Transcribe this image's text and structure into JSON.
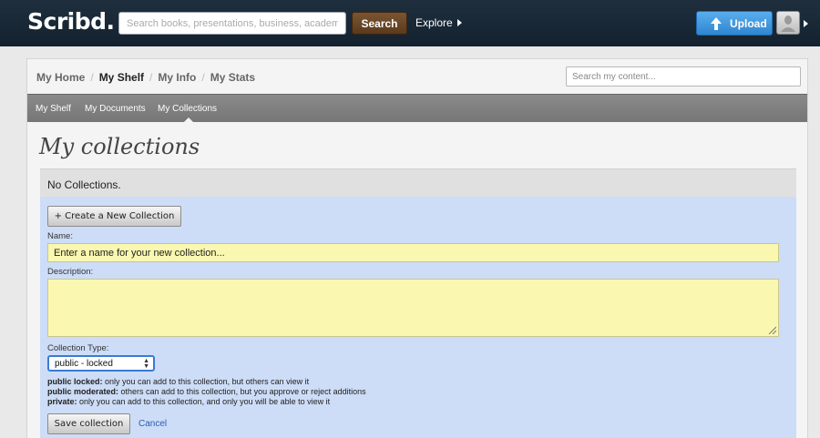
{
  "topbar": {
    "logo": "Scribd.",
    "search_placeholder": "Search books, presentations, business, academics...",
    "search_button": "Search",
    "explore": "Explore",
    "upload": "Upload"
  },
  "breadcrumbs": {
    "items": [
      "My Home",
      "My Shelf",
      "My Info",
      "My Stats"
    ],
    "active": "My Shelf",
    "separator": "/"
  },
  "content_search_placeholder": "Search my content...",
  "subnav": {
    "items": [
      "My Shelf",
      "My Documents",
      "My Collections"
    ],
    "active": "My Collections"
  },
  "page_title": "My collections",
  "empty_message": "No Collections.",
  "form": {
    "create_button": "+ Create a New Collection",
    "name_label": "Name:",
    "name_value": "Enter a name for your new collection...",
    "description_label": "Description:",
    "description_value": "",
    "type_label": "Collection Type:",
    "type_selected": "public - locked",
    "type_descriptions": [
      {
        "term": "public locked:",
        "text": " only you can add to this collection, but others can view it"
      },
      {
        "term": "public moderated:",
        "text": " others can add to this collection, but you approve or reject additions"
      },
      {
        "term": "private:",
        "text": " only you can add to this collection, and only you will be able to view it"
      }
    ],
    "save_button": "Save collection",
    "cancel_link": "Cancel"
  },
  "colors": {
    "topbar_bg": "#1a2a38",
    "search_button_bg": "#6b4726",
    "upload_button_bg": "#3d93dc",
    "form_bg": "#cdddf7",
    "input_bg": "#faf7b0",
    "link": "#2a5db0"
  }
}
